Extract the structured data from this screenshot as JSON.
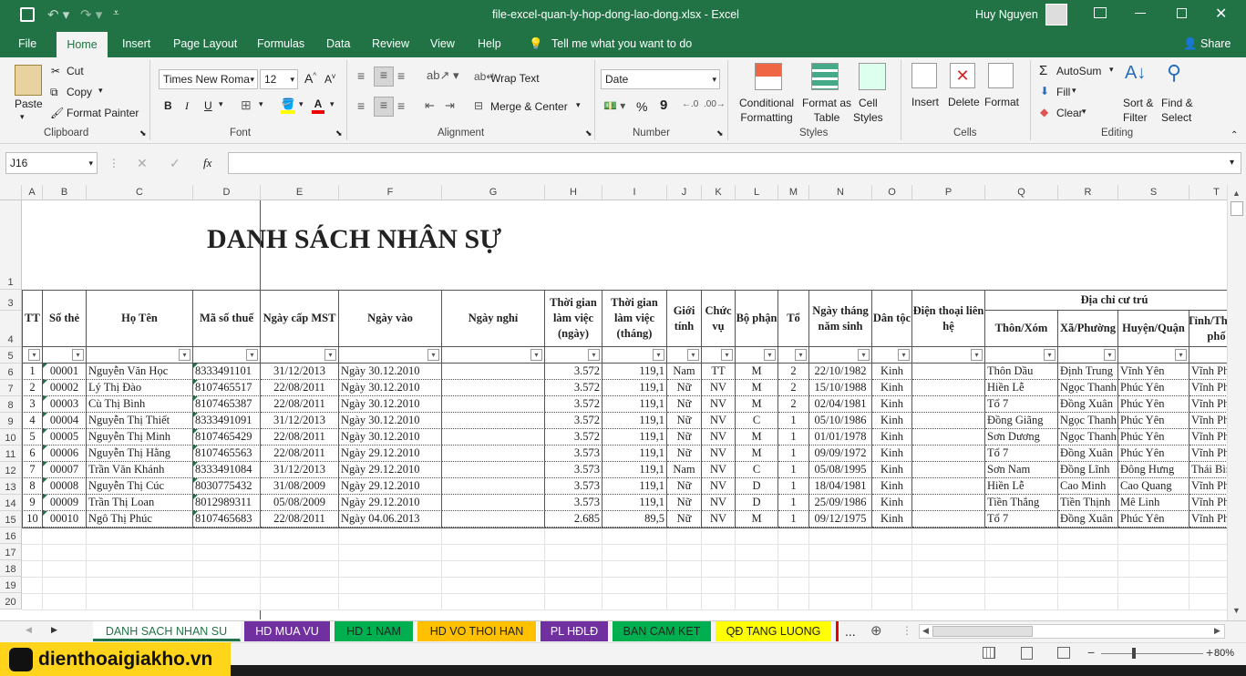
{
  "window": {
    "title": "file-excel-quan-ly-hop-dong-lao-dong.xlsx  -  Excel",
    "user": "Huy Nguyen"
  },
  "tabs": [
    "File",
    "Home",
    "Insert",
    "Page Layout",
    "Formulas",
    "Data",
    "Review",
    "View",
    "Help"
  ],
  "tell_me": "Tell me what you want to do",
  "share": "Share",
  "ribbon": {
    "paste": "Paste",
    "cut": "Cut",
    "copy": "Copy",
    "format_painter": "Format Painter",
    "clipboard": "Clipboard",
    "font_name": "Times New Roma",
    "font_size": "12",
    "font_group": "Font",
    "bold": "B",
    "italic": "I",
    "underline": "U",
    "wrap_text": "Wrap Text",
    "merge_center": "Merge & Center",
    "alignment": "Alignment",
    "number_format": "Date",
    "number": "Number",
    "percent": "%",
    "comma": "9",
    "conditional_formatting": "Conditional\nFormatting",
    "format_as_table": "Format as\nTable",
    "cell_styles": "Cell\nStyles",
    "styles": "Styles",
    "insert": "Insert",
    "delete": "Delete",
    "format": "Format",
    "cells": "Cells",
    "autosum": "AutoSum",
    "fill": "Fill",
    "clear": "Clear",
    "sort_filter": "Sort &\nFilter",
    "find_select": "Find &\nSelect",
    "editing": "Editing"
  },
  "formula_bar": {
    "name_box": "J16",
    "fx": "fx",
    "value": ""
  },
  "columns": [
    "A",
    "B",
    "C",
    "D",
    "E",
    "F",
    "G",
    "H",
    "I",
    "J",
    "K",
    "L",
    "M",
    "N",
    "O",
    "P",
    "Q",
    "R",
    "S",
    "T"
  ],
  "rows": [
    "1",
    "3",
    "4",
    "5",
    "6",
    "7",
    "8",
    "9",
    "10",
    "11",
    "12",
    "13",
    "14",
    "15",
    "16",
    "17",
    "18",
    "19",
    "20"
  ],
  "sheet_title": "DANH SÁCH NHÂN SỰ",
  "headers": {
    "tt": "TT",
    "so_the": "Số thẻ",
    "ho_ten": "Họ Tên",
    "mst": "Mã số thuế",
    "ngay_cap": "Ngày cấp MST",
    "ngay_vao": "Ngày vào",
    "ngay_nghi": "Ngày nghỉ",
    "tg_ngay": "Thời gian làm việc (ngày)",
    "tg_thang": "Thời gian làm việc (tháng)",
    "gioi_tinh": "Giới tính",
    "chuc_vu": "Chức vụ",
    "bo_phan": "Bộ phận",
    "to": "Tổ",
    "ngay_sinh": "Ngày tháng năm sinh",
    "dan_toc": "Dân tộc",
    "dien_thoai": "Điện thoại liên hệ",
    "dia_chi": "Địa chỉ cư trú",
    "thon": "Thôn/Xóm",
    "xa": "Xã/Phường",
    "huyen": "Huyện/Quận",
    "tinh": "Tỉnh/Thành phố"
  },
  "records": [
    [
      "1",
      "00001",
      "Nguyễn Văn Học",
      "8333491101",
      "31/12/2013",
      "Ngày 30.12.2010",
      "",
      "3.572",
      "119,1",
      "Nam",
      "TT",
      "M",
      "2",
      "22/10/1982",
      "Kinh",
      "",
      "Thôn Dầu",
      "Định Trung",
      "Vĩnh Yên",
      "Vĩnh Phúc"
    ],
    [
      "2",
      "00002",
      "Lý Thị Đào",
      "8107465517",
      "22/08/2011",
      "Ngày 30.12.2010",
      "",
      "3.572",
      "119,1",
      "Nữ",
      "NV",
      "M",
      "2",
      "15/10/1988",
      "Kinh",
      "",
      "Hiền Lễ",
      "Ngọc Thanh",
      "Phúc Yên",
      "Vĩnh Phúc"
    ],
    [
      "3",
      "00003",
      "Cù Thị Bình",
      "8107465387",
      "22/08/2011",
      "Ngày 30.12.2010",
      "",
      "3.572",
      "119,1",
      "Nữ",
      "NV",
      "M",
      "2",
      "02/04/1981",
      "Kinh",
      "",
      "Tổ 7",
      "Đồng Xuân",
      "Phúc Yên",
      "Vĩnh Phúc"
    ],
    [
      "4",
      "00004",
      "Nguyễn Thị Thiết",
      "8333491091",
      "31/12/2013",
      "Ngày 30.12.2010",
      "",
      "3.572",
      "119,1",
      "Nữ",
      "NV",
      "C",
      "1",
      "05/10/1986",
      "Kinh",
      "",
      "Đồng Giãng",
      "Ngọc Thanh",
      "Phúc Yên",
      "Vĩnh Phúc"
    ],
    [
      "5",
      "00005",
      "Nguyễn Thị Minh",
      "8107465429",
      "22/08/2011",
      "Ngày 30.12.2010",
      "",
      "3.572",
      "119,1",
      "Nữ",
      "NV",
      "M",
      "1",
      "01/01/1978",
      "Kinh",
      "",
      "Sơn Dương",
      "Ngọc Thanh",
      "Phúc Yên",
      "Vĩnh Phúc"
    ],
    [
      "6",
      "00006",
      "Nguyễn Thị Hằng",
      "8107465563",
      "22/08/2011",
      "Ngày 29.12.2010",
      "",
      "3.573",
      "119,1",
      "Nữ",
      "NV",
      "M",
      "1",
      "09/09/1972",
      "Kinh",
      "",
      "Tổ 7",
      "Đồng Xuân",
      "Phúc Yên",
      "Vĩnh Phúc"
    ],
    [
      "7",
      "00007",
      "Trần Văn Khánh",
      "8333491084",
      "31/12/2013",
      "Ngày 29.12.2010",
      "",
      "3.573",
      "119,1",
      "Nam",
      "NV",
      "C",
      "1",
      "05/08/1995",
      "Kinh",
      "",
      "Sơn Nam",
      "Đồng Lĩnh",
      "Đông Hưng",
      "Thái Bình"
    ],
    [
      "8",
      "00008",
      "Nguyễn Thị Cúc",
      "8030775432",
      "31/08/2009",
      "Ngày 29.12.2010",
      "",
      "3.573",
      "119,1",
      "Nữ",
      "NV",
      "D",
      "1",
      "18/04/1981",
      "Kinh",
      "",
      "Hiền Lễ",
      "Cao Minh",
      "Cao Quang",
      "Vĩnh Phúc"
    ],
    [
      "9",
      "00009",
      "Trần Thị Loan",
      "8012989311",
      "05/08/2009",
      "Ngày 29.12.2010",
      "",
      "3.573",
      "119,1",
      "Nữ",
      "NV",
      "D",
      "1",
      "25/09/1986",
      "Kinh",
      "",
      "Tiền Thắng",
      "Tiền Thịnh",
      "Mê Linh",
      "Vĩnh Phúc"
    ],
    [
      "10",
      "00010",
      "Ngô Thị Phúc",
      "8107465683",
      "22/08/2011",
      "Ngày 04.06.2013",
      "",
      "2.685",
      "89,5",
      "Nữ",
      "NV",
      "M",
      "1",
      "09/12/1975",
      "Kinh",
      "",
      "Tổ 7",
      "Đồng Xuân",
      "Phúc Yên",
      "Vĩnh Phúc"
    ]
  ],
  "sheets": [
    {
      "name": "DANH SACH NHAN SU",
      "color": "#ffffff"
    },
    {
      "name": "HD MUA VU",
      "color": "#7030a0"
    },
    {
      "name": "HD 1 NAM",
      "color": "#00b050"
    },
    {
      "name": "HD VO THOI HAN",
      "color": "#ffc000"
    },
    {
      "name": "PL HĐLĐ",
      "color": "#7030a0"
    },
    {
      "name": "BAN CAM KET",
      "color": "#00b050"
    },
    {
      "name": "QĐ TANG LUONG",
      "color": "#ffff00"
    }
  ],
  "more_sheets": "...",
  "zoom": "80%",
  "logo": "dienthoaigiakho.vn"
}
